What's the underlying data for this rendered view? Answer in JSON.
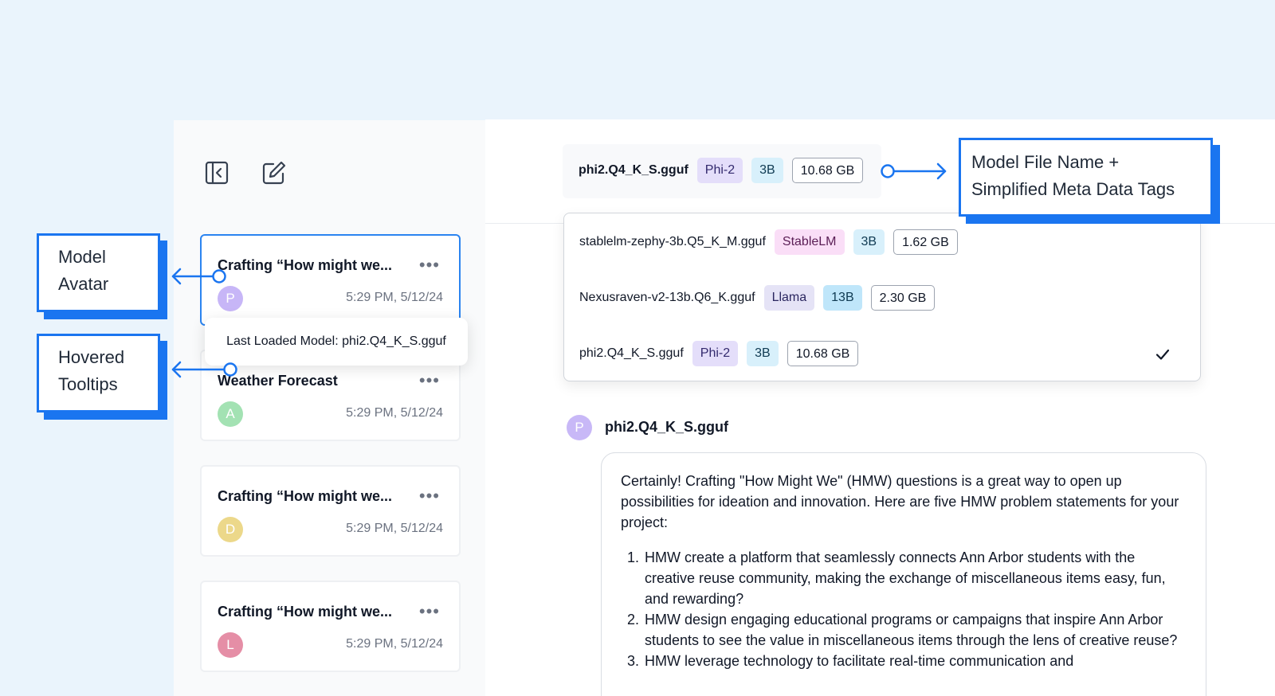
{
  "sidebar": {
    "collapse_icon": "panel-collapse-icon",
    "new_chat_icon": "compose-icon",
    "threads": [
      {
        "title": "Crafting “How might we...",
        "avatar_letter": "P",
        "avatar_color": "#c7b6f7",
        "time": "5:29 PM, 5/12/24",
        "selected": true
      },
      {
        "title": "Weather Forecast",
        "avatar_letter": "A",
        "avatar_color": "#a3e2b3",
        "time": "5:29 PM, 5/12/24",
        "selected": false
      },
      {
        "title": "Crafting “How might we...",
        "avatar_letter": "D",
        "avatar_color": "#ecd88a",
        "time": "5:29 PM, 5/12/24",
        "selected": false
      },
      {
        "title": "Crafting “How might we...",
        "avatar_letter": "L",
        "avatar_color": "#e58ea6",
        "time": "5:29 PM, 5/12/24",
        "selected": false
      }
    ],
    "more_glyph": "•••",
    "tooltip": "Last Loaded Model: phi2.Q4_K_S.gguf"
  },
  "model_selector": {
    "name": "phi2.Q4_K_S.gguf",
    "tags": {
      "family": "Phi-2",
      "params": "3B",
      "size": "10.68 GB"
    }
  },
  "dropdown": {
    "items": [
      {
        "name": "stablelm-zephy-3b.Q5_K_M.gguf",
        "family": "StableLM",
        "params": "3B",
        "size": "1.62 GB",
        "selected": false
      },
      {
        "name": "Nexusraven-v2-13b.Q6_K.gguf",
        "family": "Llama",
        "params": "13B",
        "size": "2.30 GB",
        "selected": false
      },
      {
        "name": "phi2.Q4_K_S.gguf",
        "family": "Phi-2",
        "params": "3B",
        "size": "10.68 GB",
        "selected": true
      }
    ],
    "check_icon": "check-icon"
  },
  "message": {
    "avatar_letter": "P",
    "sender": "phi2.Q4_K_S.gguf",
    "intro": "Certainly! Crafting \"How Might We\" (HMW) questions is a great way to open up possibilities for ideation and innovation. Here are five HMW problem statements for your project:",
    "items": [
      "HMW create a platform that seamlessly connects Ann Arbor students with the creative reuse community, making the exchange of miscellaneous items easy, fun, and rewarding?",
      "HMW design engaging educational programs or campaigns that inspire Ann Arbor students to see the value in miscellaneous items through the lens of creative reuse?",
      "HMW leverage technology to facilitate real-time communication and"
    ]
  },
  "callouts": {
    "avatar": [
      "Model",
      "Avatar"
    ],
    "tooltips": [
      "Hovered",
      "Tooltips"
    ],
    "meta": [
      "Model File Name +",
      "Simplified Meta Data Tags"
    ]
  },
  "colors": {
    "background": "#eaf4fc",
    "accent": "#1a75f0",
    "selected_border": "#2b84f0"
  }
}
